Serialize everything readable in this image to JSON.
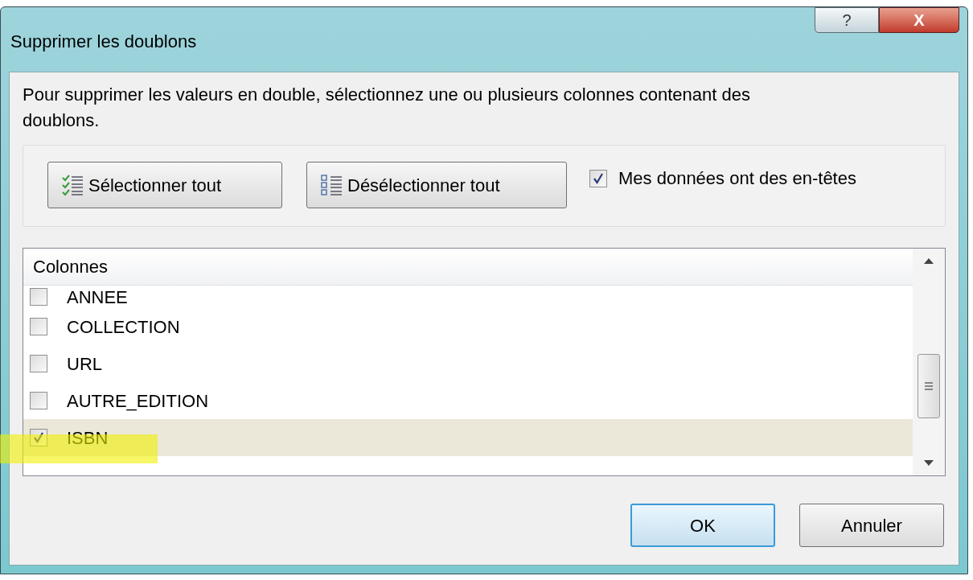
{
  "window": {
    "title": "Supprimer les doublons",
    "help_button": "?",
    "close_button": "X"
  },
  "description": "Pour supprimer les valeurs en double, sélectionnez une ou plusieurs colonnes contenant des doublons.",
  "toolbar": {
    "select_all": "Sélectionner tout",
    "deselect_all": "Désélectionner tout",
    "headers_checkbox": {
      "label": "Mes données ont des en-têtes",
      "checked": true
    }
  },
  "columns_list": {
    "header": "Colonnes",
    "items": [
      {
        "label": "ANNEE",
        "checked": false,
        "selected": false
      },
      {
        "label": "COLLECTION",
        "checked": false,
        "selected": false
      },
      {
        "label": "URL",
        "checked": false,
        "selected": false
      },
      {
        "label": "AUTRE_EDITION",
        "checked": false,
        "selected": false
      },
      {
        "label": "ISBN",
        "checked": true,
        "selected": true
      }
    ]
  },
  "buttons": {
    "ok": "OK",
    "cancel": "Annuler"
  }
}
